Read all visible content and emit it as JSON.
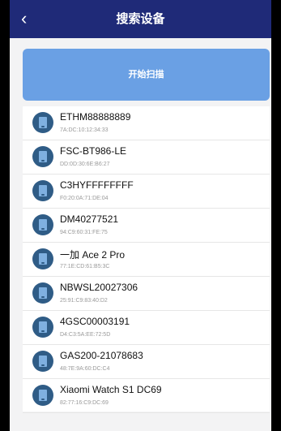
{
  "header": {
    "back_glyph": "‹",
    "title": "搜索设备"
  },
  "scan_button": {
    "label": "开始扫描"
  },
  "devices": [
    {
      "name": "ETHM88888889",
      "mac": "7A:DC:10:12:34:33"
    },
    {
      "name": "FSC-BT986-LE",
      "mac": "DD:0D:30:6E:B6:27"
    },
    {
      "name": "C3HYFFFFFFFF",
      "mac": "F0:20:0A:71:DE:04"
    },
    {
      "name": "DM40277521",
      "mac": "94:C9:60:31:FE:75"
    },
    {
      "name": "一加 Ace 2 Pro",
      "mac": "77:1E:CD:61:B5:3C"
    },
    {
      "name": "NBWSL20027306",
      "mac": "25:91:C9:83:40:D2"
    },
    {
      "name": "4GSC00003191",
      "mac": "D4:C3:5A:EE:72:5D"
    },
    {
      "name": "GAS200-21078683",
      "mac": "48:7E:9A:60:DC:C4"
    },
    {
      "name": "Xiaomi Watch S1 DC69",
      "mac": "82:77:16:C9:DC:69"
    }
  ],
  "device_icon": "phone-icon",
  "colors": {
    "header": "#1f2a78",
    "scan_button": "#6aa0e4",
    "icon": "#2f5c86"
  }
}
